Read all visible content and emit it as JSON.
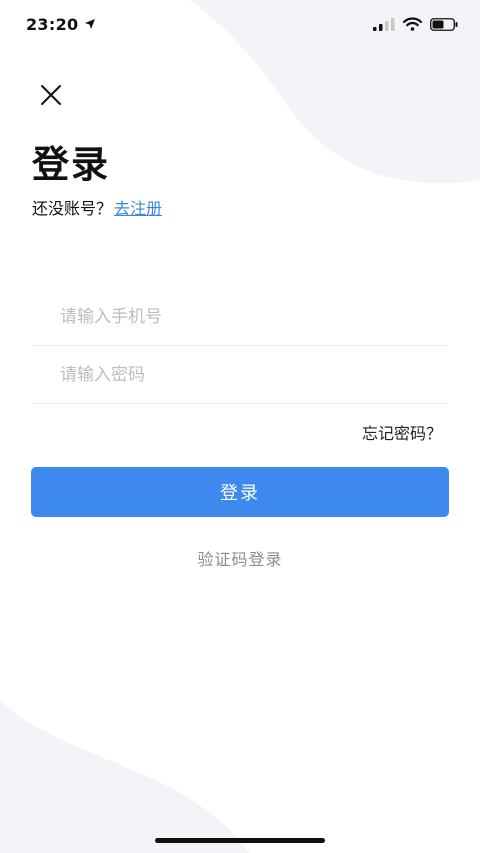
{
  "status_bar": {
    "time": "23:20",
    "icons": [
      "location-arrow-icon",
      "signal-icon",
      "wifi-icon",
      "battery-icon"
    ]
  },
  "header": {
    "close_icon": "close-icon",
    "title": "登录"
  },
  "register": {
    "prompt": "还没账号？",
    "link": "去注册"
  },
  "form": {
    "phone_placeholder": "请输入手机号",
    "phone_value": "",
    "password_placeholder": "请输入密码",
    "password_value": "",
    "forgot_label": "忘记密码？",
    "login_label": "登录",
    "sms_login_label": "验证码登录"
  },
  "colors": {
    "accent": "#3D89EE",
    "link": "#3D86E0",
    "placeholder": "#BDBDBD",
    "muted_text": "#8C8C8C",
    "background_shape": "#F3F4F8"
  }
}
